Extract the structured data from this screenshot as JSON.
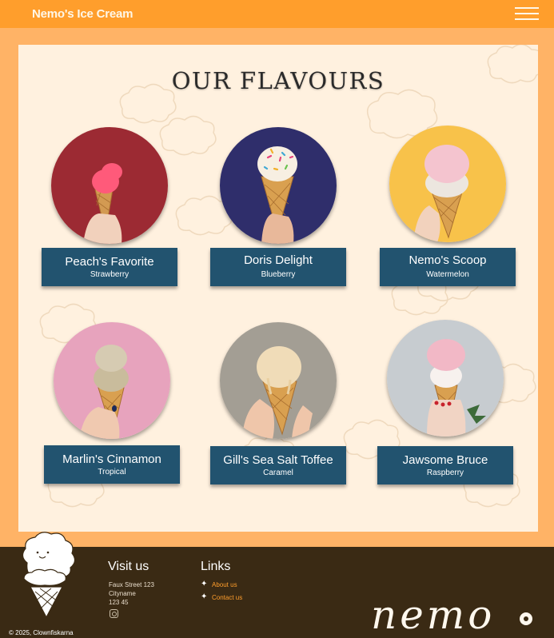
{
  "header": {
    "brand": "Nemo's Ice Cream",
    "menu_icon": "hamburger-menu-icon"
  },
  "main": {
    "title": "OUR FLAVOURS",
    "flavours": [
      {
        "name": "Peach's Favorite",
        "flavour": "Strawberry",
        "photo_bg": "#9c2a33",
        "scoop_colors": [
          "#ff5a7a"
        ]
      },
      {
        "name": "Doris Delight",
        "flavour": "Blueberry",
        "photo_bg": "#2f2e6b",
        "scoop_colors": [
          "#f7efe2"
        ]
      },
      {
        "name": "Nemo's Scoop",
        "flavour": "Watermelon",
        "photo_bg": "#f8c24a",
        "scoop_colors": [
          "#f4c4cf",
          "#ece6df"
        ]
      },
      {
        "name": "Marlin's Cinnamon",
        "flavour": "Tropical",
        "photo_bg": "#e7a3bd",
        "scoop_colors": [
          "#d6cbb2",
          "#c9bc9c"
        ]
      },
      {
        "name": "Gill's Sea Salt Toffee",
        "flavour": "Caramel",
        "photo_bg": "#a39e94",
        "scoop_colors": [
          "#f0dcb8"
        ]
      },
      {
        "name": "Jawsome Bruce",
        "flavour": "Raspberry",
        "photo_bg": "#c7ccd0",
        "scoop_colors": [
          "#f2b8c6",
          "#f7f1ee"
        ]
      }
    ]
  },
  "footer": {
    "visit_title": "Visit us",
    "address": [
      "Faux Street 123",
      "Cityname",
      "123 45"
    ],
    "instagram_icon": "instagram-icon",
    "links_title": "Links",
    "links": [
      "About us",
      "Contact us"
    ],
    "copyright": "© 2025, Clownfiskarna",
    "logo": "nemo"
  },
  "colors": {
    "page_bg": "#ffb366",
    "header_bg": "#ff9e2c",
    "panel_bg": "#fff1df",
    "card_bg": "#22536f",
    "footer_bg": "#3a2a14",
    "link": "#ff9e2c"
  }
}
